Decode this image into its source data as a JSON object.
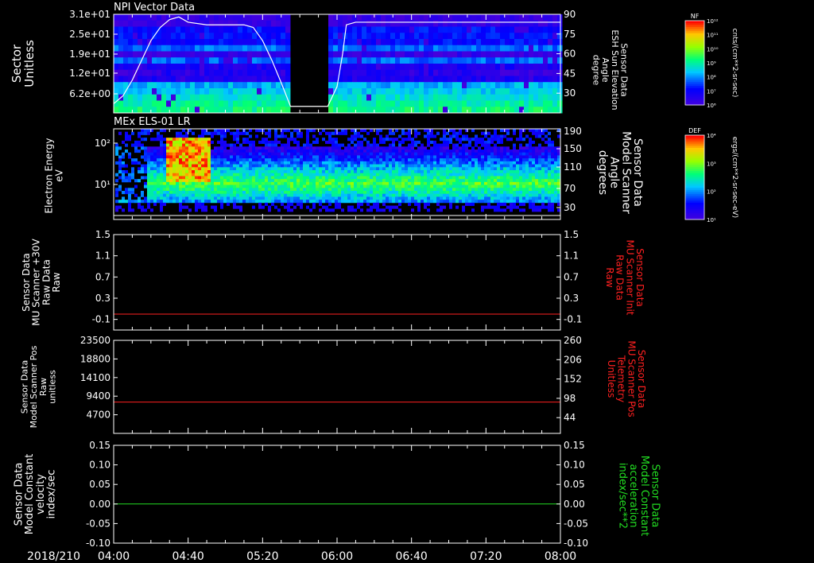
{
  "footer": {
    "date_label": "2018/210"
  },
  "colors": {
    "red": "#ff2020",
    "green": "#22dd22",
    "white": "#ffffff",
    "frame": "#ffffff"
  },
  "chart_data": [
    {
      "type": "heatmap",
      "title": "NPI Vector Data",
      "ylabel": [
        "Sector",
        "Unitless"
      ],
      "y_ticks": [
        "3.1e+01",
        "2.5e+01",
        "1.9e+01",
        "1.2e+01",
        "6.2e+00"
      ],
      "ylabel_right": [
        "Sensor Data",
        "ESH Sun Elevation",
        "Angle",
        "degree"
      ],
      "y_ticks_right": [
        "90",
        "75",
        "60",
        "45",
        "30"
      ],
      "ylim_right": [
        15,
        90
      ],
      "colorbar": {
        "label": "NF",
        "unit": "cnts/(cm**2-sr-sec)",
        "ticks": [
          "10¹²",
          "10¹¹",
          "10¹⁰",
          "10⁹",
          "10⁸",
          "10⁷",
          "10⁶"
        ]
      },
      "data_gap": {
        "start": "05:35",
        "end": "05:55"
      },
      "overlay_line": {
        "color": "white",
        "x": [
          "04:00",
          "04:05",
          "04:10",
          "04:15",
          "04:20",
          "04:25",
          "04:30",
          "04:35",
          "04:40",
          "04:50",
          "05:00",
          "05:10",
          "05:15",
          "05:20",
          "05:25",
          "05:30",
          "05:35",
          "05:55",
          "06:00",
          "06:03",
          "06:05",
          "06:10",
          "06:20",
          "06:40",
          "07:00",
          "07:20",
          "07:40",
          "08:00"
        ],
        "y": [
          22,
          28,
          40,
          55,
          70,
          80,
          86,
          88,
          84,
          82,
          82,
          82,
          80,
          70,
          55,
          38,
          20,
          20,
          35,
          60,
          82,
          84,
          84,
          84,
          84,
          84,
          84,
          84
        ]
      }
    },
    {
      "type": "heatmap",
      "title": "MEx ELS-01 LR",
      "ylabel": [
        "Electron Energy",
        "eV"
      ],
      "y_ticks": [
        "10²",
        "10¹"
      ],
      "ylabel_right": [
        "Sensor Data",
        "Model Scanner",
        "Angle",
        "degrees"
      ],
      "y_ticks_right": [
        "190",
        "150",
        "110",
        "70",
        "30"
      ],
      "colorbar": {
        "label": "DEF",
        "unit": "ergs/(cm**2-sr-sec-eV)",
        "ticks": [
          "10⁴",
          "10³",
          "10²",
          "10¹"
        ]
      }
    },
    {
      "type": "line",
      "ylabel": [
        "Sensor Data",
        "MU Scanner +30V",
        "Raw Data",
        "Raw"
      ],
      "ylabel_right": [
        "Sensor Data",
        "MU Scanner Init",
        "Raw Data",
        "Raw"
      ],
      "ylim": [
        -0.3,
        1.5
      ],
      "y_ticks": [
        "1.5",
        "1.1",
        "0.7",
        "0.3",
        "-0.1"
      ],
      "y_tick_values": [
        1.5,
        1.1,
        0.7,
        0.3,
        -0.1
      ],
      "series": [
        {
          "color": "red",
          "x": [
            "04:00",
            "08:00"
          ],
          "y": [
            0.0,
            0.0
          ]
        }
      ]
    },
    {
      "type": "line",
      "ylabel": [
        "Sensor Data",
        "Model Scanner Pos",
        "Raw",
        "unitless"
      ],
      "ylabel_right": [
        "Sensor Data",
        "MU Scanner Pos",
        "Telemetry",
        "Unitless"
      ],
      "ylim": [
        0,
        23500
      ],
      "y_ticks": [
        "23500",
        "18800",
        "14100",
        "9400",
        "4700"
      ],
      "y_tick_values": [
        23500,
        18800,
        14100,
        9400,
        4700
      ],
      "ylim_right": [
        0,
        260
      ],
      "y_ticks_right": [
        "260",
        "206",
        "152",
        "98",
        "44"
      ],
      "y_tick_values_right": [
        260,
        206,
        152,
        98,
        44
      ],
      "series": [
        {
          "color": "red",
          "x": [
            "04:00",
            "08:00"
          ],
          "y": [
            7900,
            7900
          ]
        }
      ]
    },
    {
      "type": "line",
      "ylabel": [
        "Sensor Data",
        "Model Constant",
        "velocity",
        "index/sec"
      ],
      "ylabel_right": [
        "Sensor Data",
        "Model Constant",
        "acceleration",
        "index/sec**2"
      ],
      "ylim": [
        -0.1,
        0.15
      ],
      "y_ticks": [
        "0.15",
        "0.10",
        "0.05",
        "0.00",
        "-0.05",
        "-0.10"
      ],
      "y_tick_values": [
        0.15,
        0.1,
        0.05,
        0.0,
        -0.05,
        -0.1
      ],
      "series": [
        {
          "color": "green",
          "x": [
            "04:00",
            "08:00"
          ],
          "y": [
            0.0,
            0.0
          ]
        }
      ]
    }
  ],
  "x_axis": {
    "range": [
      "04:00",
      "08:00"
    ],
    "tick_labels": [
      "04:00",
      "04:40",
      "05:20",
      "06:00",
      "06:40",
      "07:20",
      "08:00"
    ]
  }
}
